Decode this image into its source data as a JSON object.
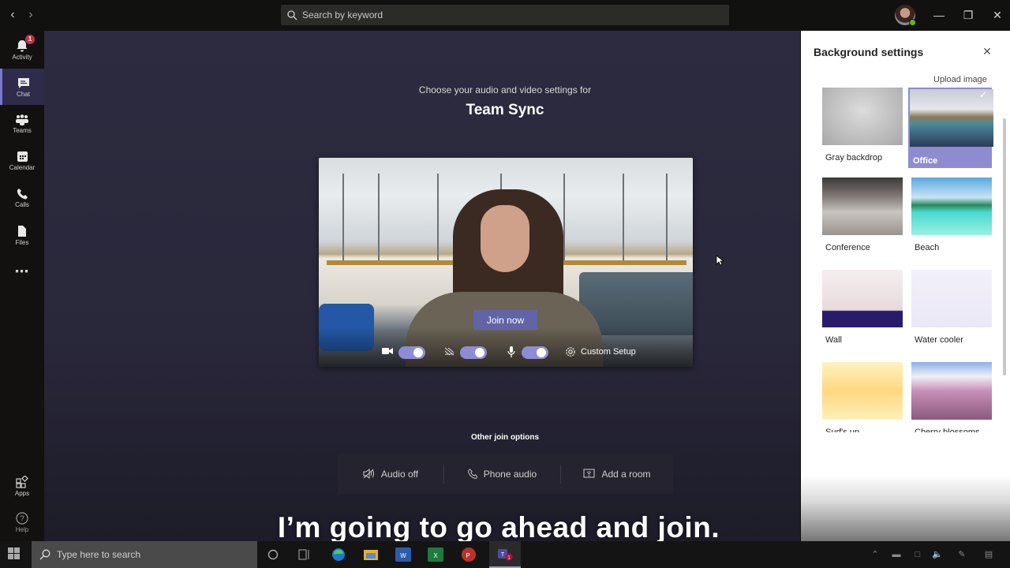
{
  "titlebar": {
    "search_placeholder": "Search by keyword",
    "back_icon": "chevron-left-icon",
    "forward_icon": "chevron-right-icon",
    "window_controls": [
      "minimize",
      "maximize",
      "close"
    ]
  },
  "rail": {
    "items": [
      {
        "label": "Activity",
        "icon": "bell-icon",
        "badge": "1"
      },
      {
        "label": "Chat",
        "icon": "chat-icon",
        "active": true
      },
      {
        "label": "Teams",
        "icon": "teams-icon"
      },
      {
        "label": "Calendar",
        "icon": "calendar-icon"
      },
      {
        "label": "Calls",
        "icon": "phone-icon"
      },
      {
        "label": "Files",
        "icon": "file-icon"
      },
      {
        "label": "...",
        "icon": "more-icon"
      }
    ],
    "bottom": [
      {
        "label": "Apps",
        "icon": "apps-icon"
      },
      {
        "label": "Help",
        "icon": "help-icon"
      }
    ]
  },
  "prejoin": {
    "subtitle": "Choose your audio and video settings for",
    "meeting_title": "Team Sync",
    "join_button": "Join now",
    "camera_on": true,
    "background_blur_on": true,
    "mic_on": true,
    "custom_setup": "Custom Setup",
    "other_join_title": "Other join options",
    "options": [
      {
        "label": "Audio off",
        "icon": "speaker-off-icon"
      },
      {
        "label": "Phone audio",
        "icon": "phone-icon"
      },
      {
        "label": "Add a room",
        "icon": "cast-room-icon"
      }
    ]
  },
  "caption": "I’m going to go ahead and join.",
  "background_panel": {
    "title": "Background settings",
    "upload_label": "Upload image",
    "selected": "Office",
    "backgrounds": [
      {
        "name": "Gray backdrop"
      },
      {
        "name": "Office"
      },
      {
        "name": "Conference"
      },
      {
        "name": "Beach"
      },
      {
        "name": "Wall"
      },
      {
        "name": "Water cooler"
      },
      {
        "name": "Surf's up"
      },
      {
        "name": "Cherry blossoms"
      }
    ]
  },
  "taskbar": {
    "search_placeholder": "Type here to search",
    "apps": [
      "cortana",
      "task-view",
      "edge",
      "file-explorer",
      "word",
      "excel",
      "powerpoint",
      "teams"
    ],
    "teams_badge": "1"
  },
  "colors": {
    "accent": "#6264a7",
    "toggle_on": "#8f8cd6",
    "badge": "#c4314b",
    "presence": "#6bb700"
  }
}
